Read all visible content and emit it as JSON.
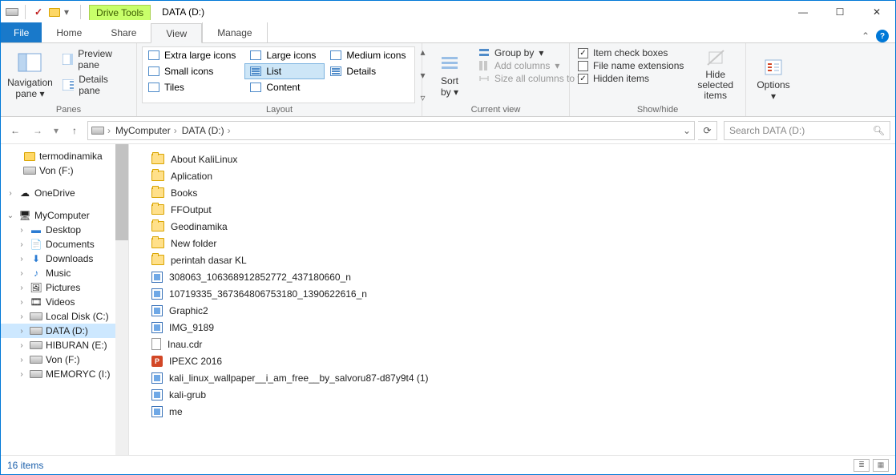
{
  "title": "DATA (D:)",
  "tool_tab": "Drive Tools",
  "tabs": {
    "file": "File",
    "home": "Home",
    "share": "Share",
    "view": "View",
    "manage": "Manage"
  },
  "ribbon": {
    "panes_group": "Panes",
    "nav_pane": "Navigation\npane",
    "preview_pane": "Preview pane",
    "details_pane": "Details pane",
    "layout_group": "Layout",
    "layouts": [
      "Extra large icons",
      "Large icons",
      "Medium icons",
      "Small icons",
      "List",
      "Details",
      "Tiles",
      "Content"
    ],
    "current_group": "Current view",
    "sort_by": "Sort\nby",
    "group_by": "Group by",
    "add_columns": "Add columns",
    "size_cols": "Size all columns to fit",
    "showhide_group": "Show/hide",
    "item_check": "Item check boxes",
    "file_ext": "File name extensions",
    "hidden": "Hidden items",
    "hide_sel": "Hide selected\nitems",
    "options": "Options"
  },
  "breadcrumb": [
    "MyComputer",
    "DATA (D:)"
  ],
  "search_placeholder": "Search DATA (D:)",
  "tree": {
    "termodinamika": "termodinamika",
    "von": "Von (F:)",
    "onedrive": "OneDrive",
    "mycomputer": "MyComputer",
    "desktop": "Desktop",
    "documents": "Documents",
    "downloads": "Downloads",
    "music": "Music",
    "pictures": "Pictures",
    "videos": "Videos",
    "localdisk": "Local Disk (C:)",
    "data": "DATA (D:)",
    "hiburan": "HIBURAN (E:)",
    "von2": "Von (F:)",
    "memoryc": "MEMORYC (I:)"
  },
  "files": [
    {
      "type": "folder",
      "name": "About KaliLinux"
    },
    {
      "type": "folder",
      "name": "Aplication"
    },
    {
      "type": "folder",
      "name": "Books"
    },
    {
      "type": "folder",
      "name": "FFOutput"
    },
    {
      "type": "folder",
      "name": "Geodinamika"
    },
    {
      "type": "folder",
      "name": "New folder"
    },
    {
      "type": "folder",
      "name": "perintah dasar KL"
    },
    {
      "type": "img",
      "name": "308063_106368912852772_437180660_n"
    },
    {
      "type": "img",
      "name": "10719335_367364806753180_1390622616_n"
    },
    {
      "type": "img",
      "name": "Graphic2"
    },
    {
      "type": "img",
      "name": "IMG_9189"
    },
    {
      "type": "doc",
      "name": "Inau.cdr"
    },
    {
      "type": "ppt",
      "name": "IPEXC 2016"
    },
    {
      "type": "img",
      "name": "kali_linux_wallpaper__i_am_free__by_salvoru87-d87y9t4 (1)"
    },
    {
      "type": "img",
      "name": "kali-grub"
    },
    {
      "type": "img",
      "name": "me"
    }
  ],
  "status": "16 items"
}
